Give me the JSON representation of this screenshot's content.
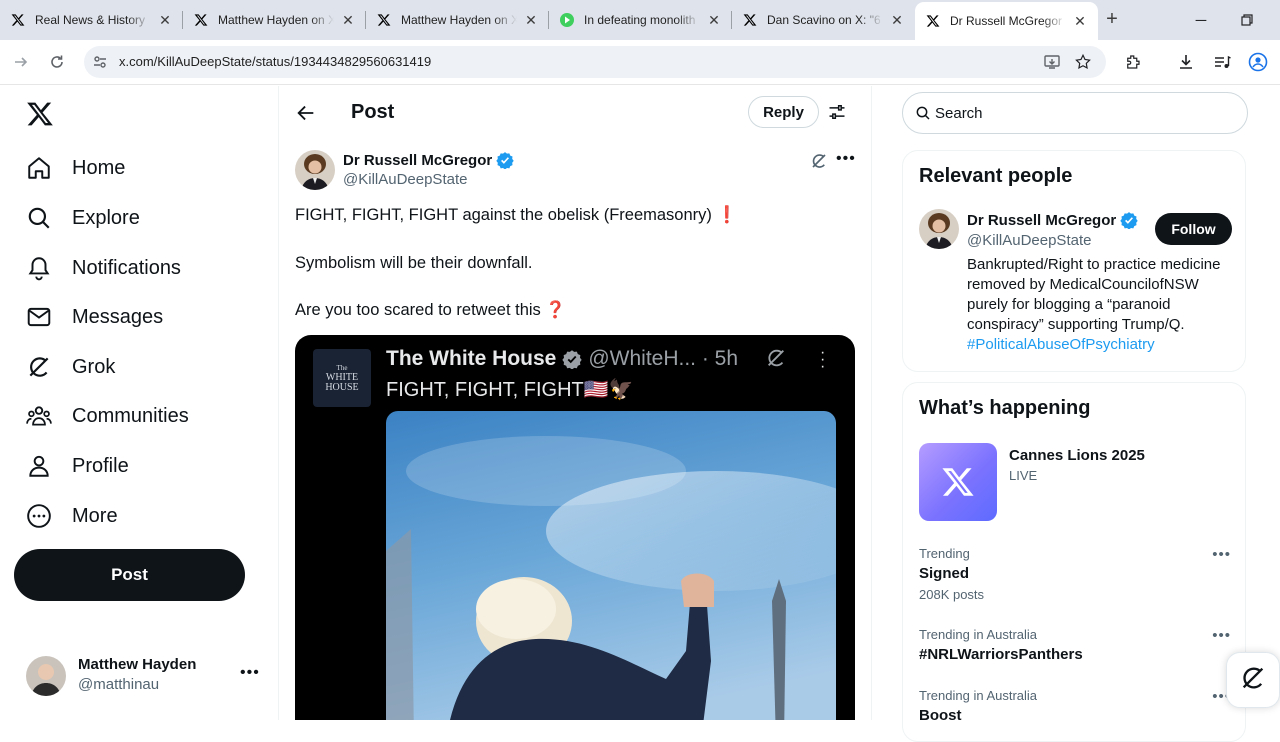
{
  "browser": {
    "tabs": [
      {
        "title": "Real News & History",
        "icon": "x-favicon"
      },
      {
        "title": "Matthew Hayden on X",
        "icon": "x-favicon"
      },
      {
        "title": "Matthew Hayden on X",
        "icon": "x-favicon"
      },
      {
        "title": "In defeating monolith",
        "icon": "play-favicon"
      },
      {
        "title": "Dan Scavino on X: \"6",
        "icon": "x-favicon"
      },
      {
        "title": "Dr Russell McGregor",
        "icon": "x-favicon",
        "active": true
      }
    ],
    "url": "x.com/KillAuDeepState/status/1934434829560631419"
  },
  "nav": {
    "items": [
      {
        "label": "Home",
        "icon": "home-icon"
      },
      {
        "label": "Explore",
        "icon": "search-icon"
      },
      {
        "label": "Notifications",
        "icon": "bell-icon"
      },
      {
        "label": "Messages",
        "icon": "envelope-icon"
      },
      {
        "label": "Grok",
        "icon": "grok-icon"
      },
      {
        "label": "Communities",
        "icon": "people-icon"
      },
      {
        "label": "Profile",
        "icon": "person-icon"
      },
      {
        "label": "More",
        "icon": "more-circle-icon"
      }
    ],
    "post_button": "Post"
  },
  "account": {
    "name": "Matthew Hayden",
    "handle": "@matthinau"
  },
  "header": {
    "title": "Post",
    "reply_button": "Reply"
  },
  "tweet": {
    "author_name": "Dr Russell McGregor",
    "author_handle": "@KillAuDeepState",
    "lines": [
      "FIGHT, FIGHT, FIGHT against the obelisk (Freemasonry) ❗",
      "Symbolism will be their downfall.",
      "Are you too scared to retweet this ❓"
    ],
    "embedded": {
      "logo_line1": "The",
      "logo_line2": "WHITE",
      "logo_line3": "HOUSE",
      "name": "The White House",
      "handle_time": "@WhiteH... · 5h",
      "text": "FIGHT, FIGHT, FIGHT🇺🇸🦅"
    }
  },
  "right": {
    "search_placeholder": "Search",
    "relevant": {
      "title": "Relevant people",
      "name": "Dr Russell McGregor",
      "handle": "@KillAuDeepState",
      "follow": "Follow",
      "bio": "Bankrupted/Right to practice medicine removed by MedicalCouncilofNSW purely for blogging a “paranoid conspiracy” supporting Trump/Q.",
      "hashtag": "#PoliticalAbuseOfPsychiatry"
    },
    "happening": {
      "title": "What’s happening",
      "event_title": "Cannes Lions 2025",
      "event_status": "LIVE",
      "trends": [
        {
          "context": "Trending",
          "title": "Signed",
          "count": "208K posts"
        },
        {
          "context": "Trending in Australia",
          "title": "#NRLWarriorsPanthers",
          "count": ""
        },
        {
          "context": "Trending in Australia",
          "title": "Boost",
          "count": ""
        }
      ]
    }
  },
  "colors": {
    "accent": "#1d9bf0",
    "text": "#0f1419",
    "muted": "#536471",
    "button": "#0f1419"
  }
}
